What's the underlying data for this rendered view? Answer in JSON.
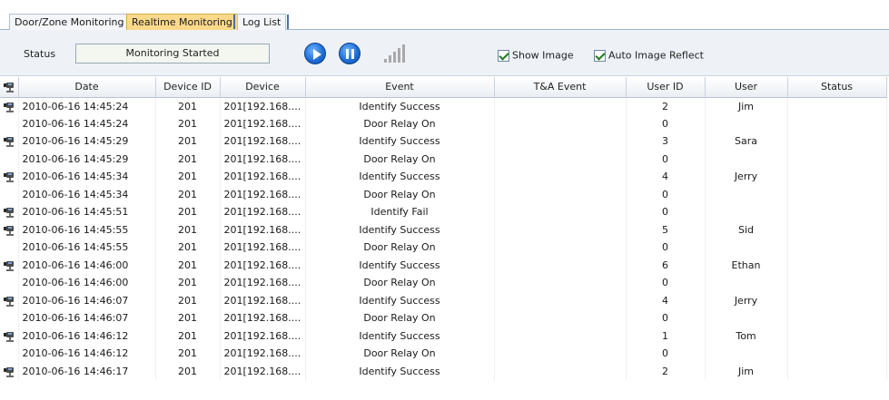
{
  "tabs": [
    {
      "label": "Door/Zone Monitoring",
      "active": false
    },
    {
      "label": "Realtime Monitoring",
      "active": true
    },
    {
      "label": "Log List",
      "active": false
    }
  ],
  "controls": {
    "status_label": "Status",
    "status_value": "Monitoring Started",
    "start_icon": "play-icon",
    "pause_icon": "pause-icon",
    "signal_icon": "signal-strength-icon",
    "show_image_label": "Show Image",
    "show_image_checked": true,
    "auto_reflect_label": "Auto Image Reflect",
    "auto_reflect_checked": true
  },
  "table": {
    "header_icon": "camera-icon",
    "columns": [
      "Date",
      "Device ID",
      "Device",
      "Event",
      "T&A Event",
      "User ID",
      "User",
      "Status"
    ],
    "rows": [
      {
        "camera": true,
        "date": "2010-06-16 14:45:24",
        "device_id": "201",
        "device": "201[192.168....",
        "event": "Identify Success",
        "ta_event": "",
        "user_id": "2",
        "user": "Jim",
        "status": ""
      },
      {
        "camera": false,
        "date": "2010-06-16 14:45:24",
        "device_id": "201",
        "device": "201[192.168....",
        "event": "Door Relay On",
        "ta_event": "",
        "user_id": "0",
        "user": "",
        "status": ""
      },
      {
        "camera": true,
        "date": "2010-06-16 14:45:29",
        "device_id": "201",
        "device": "201[192.168....",
        "event": "Identify Success",
        "ta_event": "",
        "user_id": "3",
        "user": "Sara",
        "status": ""
      },
      {
        "camera": false,
        "date": "2010-06-16 14:45:29",
        "device_id": "201",
        "device": "201[192.168....",
        "event": "Door Relay On",
        "ta_event": "",
        "user_id": "0",
        "user": "",
        "status": ""
      },
      {
        "camera": true,
        "date": "2010-06-16 14:45:34",
        "device_id": "201",
        "device": "201[192.168....",
        "event": "Identify Success",
        "ta_event": "",
        "user_id": "4",
        "user": "Jerry",
        "status": ""
      },
      {
        "camera": false,
        "date": "2010-06-16 14:45:34",
        "device_id": "201",
        "device": "201[192.168....",
        "event": "Door Relay On",
        "ta_event": "",
        "user_id": "0",
        "user": "",
        "status": ""
      },
      {
        "camera": true,
        "date": "2010-06-16 14:45:51",
        "device_id": "201",
        "device": "201[192.168....",
        "event": "Identify Fail",
        "ta_event": "",
        "user_id": "0",
        "user": "",
        "status": ""
      },
      {
        "camera": true,
        "date": "2010-06-16 14:45:55",
        "device_id": "201",
        "device": "201[192.168....",
        "event": "Identify Success",
        "ta_event": "",
        "user_id": "5",
        "user": "Sid",
        "status": ""
      },
      {
        "camera": false,
        "date": "2010-06-16 14:45:55",
        "device_id": "201",
        "device": "201[192.168....",
        "event": "Door Relay On",
        "ta_event": "",
        "user_id": "0",
        "user": "",
        "status": ""
      },
      {
        "camera": true,
        "date": "2010-06-16 14:46:00",
        "device_id": "201",
        "device": "201[192.168....",
        "event": "Identify Success",
        "ta_event": "",
        "user_id": "6",
        "user": "Ethan",
        "status": ""
      },
      {
        "camera": false,
        "date": "2010-06-16 14:46:00",
        "device_id": "201",
        "device": "201[192.168....",
        "event": "Door Relay On",
        "ta_event": "",
        "user_id": "0",
        "user": "",
        "status": ""
      },
      {
        "camera": true,
        "date": "2010-06-16 14:46:07",
        "device_id": "201",
        "device": "201[192.168....",
        "event": "Identify Success",
        "ta_event": "",
        "user_id": "4",
        "user": "Jerry",
        "status": ""
      },
      {
        "camera": false,
        "date": "2010-06-16 14:46:07",
        "device_id": "201",
        "device": "201[192.168....",
        "event": "Door Relay On",
        "ta_event": "",
        "user_id": "0",
        "user": "",
        "status": ""
      },
      {
        "camera": true,
        "date": "2010-06-16 14:46:12",
        "device_id": "201",
        "device": "201[192.168....",
        "event": "Identify Success",
        "ta_event": "",
        "user_id": "1",
        "user": "Tom",
        "status": ""
      },
      {
        "camera": false,
        "date": "2010-06-16 14:46:12",
        "device_id": "201",
        "device": "201[192.168....",
        "event": "Door Relay On",
        "ta_event": "",
        "user_id": "0",
        "user": "",
        "status": ""
      },
      {
        "camera": true,
        "date": "2010-06-16 14:46:17",
        "device_id": "201",
        "device": "201[192.168....",
        "event": "Identify Success",
        "ta_event": "",
        "user_id": "2",
        "user": "Jim",
        "status": ""
      }
    ]
  }
}
